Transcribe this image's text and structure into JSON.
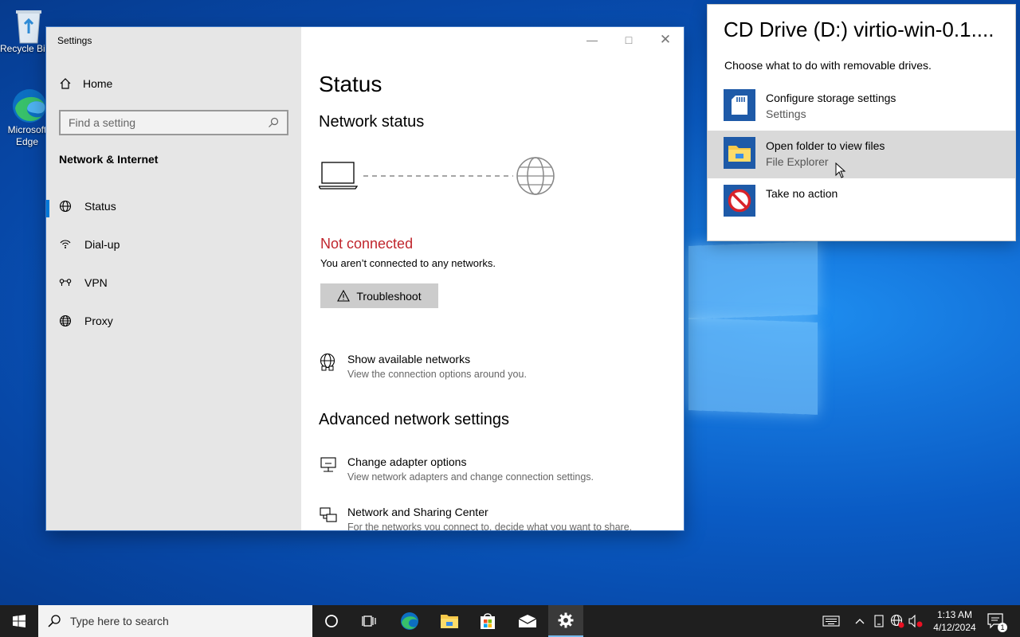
{
  "desktop": {
    "icons": [
      {
        "label": "Recycle Bin"
      },
      {
        "label": "Microsoft Edge"
      }
    ]
  },
  "settings_window": {
    "title": "Settings",
    "sidebar": {
      "home_label": "Home",
      "search_placeholder": "Find a setting",
      "section_title": "Network & Internet",
      "items": [
        {
          "label": "Status",
          "icon": "globe-network-icon",
          "active": true
        },
        {
          "label": "Dial-up",
          "icon": "dialup-icon",
          "active": false
        },
        {
          "label": "VPN",
          "icon": "vpn-icon",
          "active": false
        },
        {
          "label": "Proxy",
          "icon": "globe-icon",
          "active": false
        }
      ]
    },
    "main": {
      "title": "Status",
      "network_status_heading": "Network status",
      "connection_state": "Not connected",
      "connection_detail": "You aren’t connected to any networks.",
      "troubleshoot_label": "Troubleshoot",
      "show_networks": {
        "title": "Show available networks",
        "desc": "View the connection options around you."
      },
      "advanced_heading": "Advanced network settings",
      "change_adapter": {
        "title": "Change adapter options",
        "desc": "View network adapters and change connection settings."
      },
      "sharing_center": {
        "title": "Network and Sharing Center",
        "desc": "For the networks you connect to, decide what you want to share."
      }
    }
  },
  "autoplay": {
    "title": "CD Drive (D:) virtio-win-0.1....",
    "subtitle": "Choose what to do with removable drives.",
    "options": [
      {
        "title": "Configure storage settings",
        "subtitle": "Settings",
        "icon": "sd-card-icon"
      },
      {
        "title": "Open folder to view files",
        "subtitle": "File Explorer",
        "icon": "folder-icon"
      },
      {
        "title": "Take no action",
        "subtitle": "",
        "icon": "no-action-icon"
      }
    ]
  },
  "taskbar": {
    "search_placeholder": "Type here to search",
    "time": "1:13 AM",
    "date": "4/12/2024",
    "notification_count": "1"
  },
  "colors": {
    "accent": "#0078d7",
    "error": "#c0262d",
    "autoplay_icon_bg": "#1e5aa8"
  }
}
